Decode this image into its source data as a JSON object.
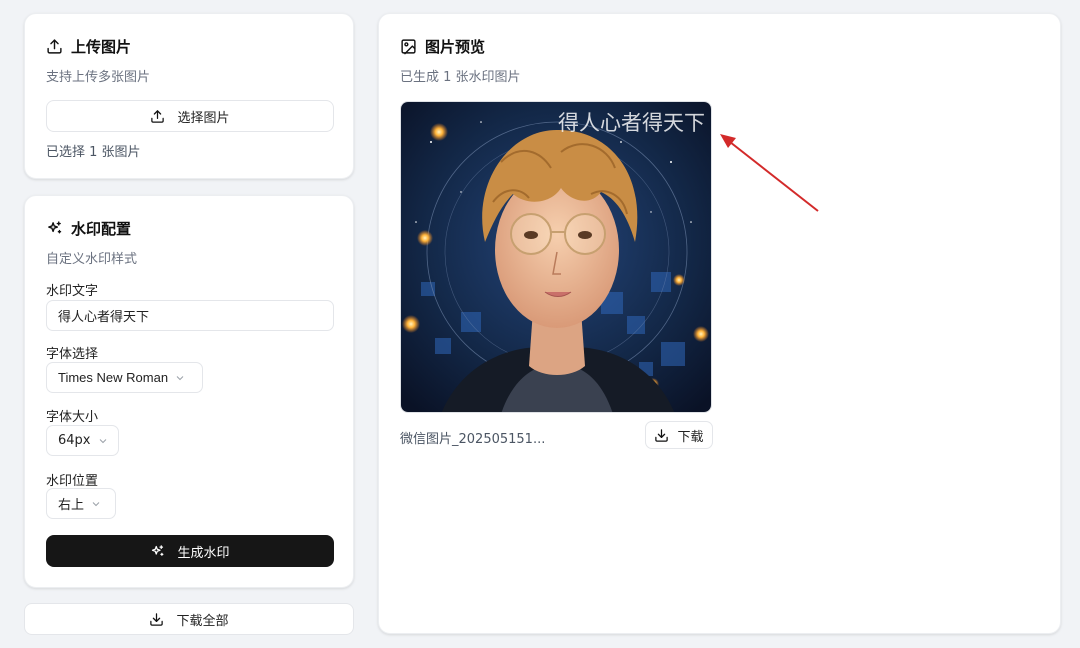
{
  "upload": {
    "title": "上传图片",
    "subtitle": "支持上传多张图片",
    "select_button": "选择图片",
    "selected_text": "已选择 1 张图片"
  },
  "config": {
    "title": "水印配置",
    "subtitle": "自定义水印样式",
    "text_label": "水印文字",
    "text_value": "得人心者得天下",
    "font_label": "字体选择",
    "font_value": "Times New Roman",
    "size_label": "字体大小",
    "size_value": "64px",
    "position_label": "水印位置",
    "position_value": "右上",
    "generate_button": "生成水印"
  },
  "download_all": "下载全部",
  "preview": {
    "title": "图片预览",
    "subtitle": "已生成 1 张水印图片",
    "image": {
      "watermark": "得人心者得天下",
      "filename": "微信图片_202505151...",
      "download_button": "下载"
    }
  },
  "colors": {
    "accent_dark": "#161616",
    "annotation_arrow": "#d32a2a"
  }
}
